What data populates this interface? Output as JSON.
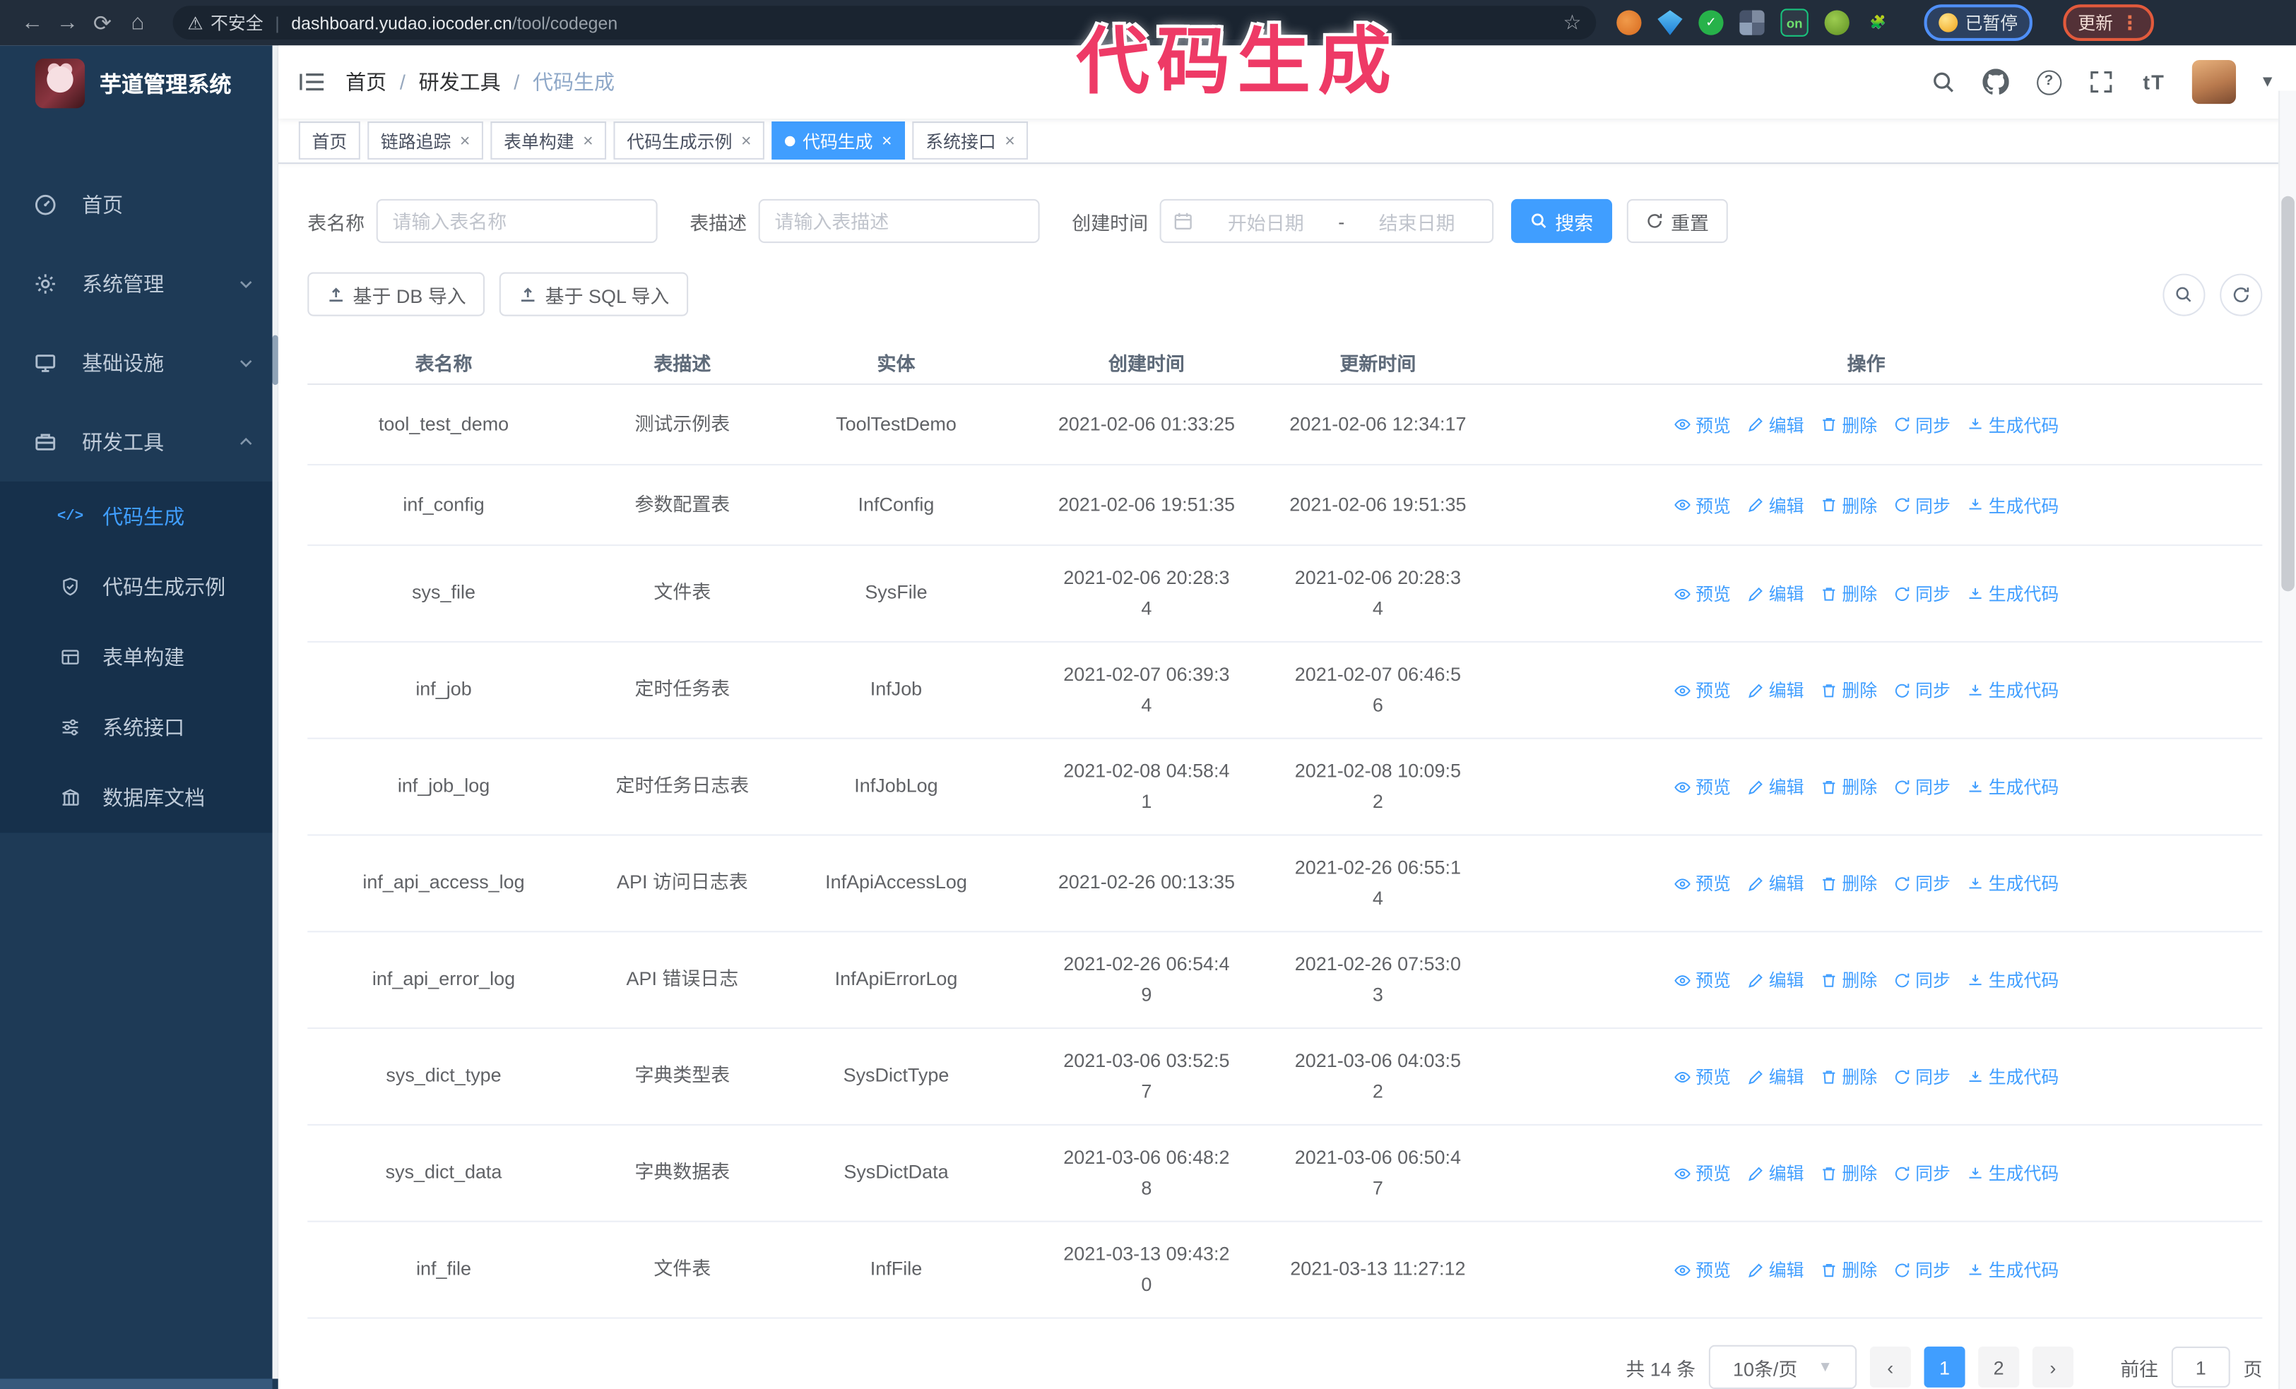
{
  "browser": {
    "security_label": "不安全",
    "url_host": "dashboard.yudao.iocoder.cn",
    "url_path": "/tool/codegen",
    "paused_badge": "已暂停",
    "update_badge": "更新",
    "extension_icons": [
      "orange-extension",
      "blue-gem-extension",
      "green-check-extension",
      "grid-extension",
      "proxy-on-extension",
      "green-extension",
      "puzzle-extension"
    ]
  },
  "annotation": {
    "text": "代码生成",
    "color": "#ee3a66"
  },
  "sidebar": {
    "title": "芋道管理系统",
    "items": [
      {
        "label": "首页",
        "icon": "gauge-icon"
      },
      {
        "label": "系统管理",
        "icon": "gear-icon",
        "state": "collapsed"
      },
      {
        "label": "基础设施",
        "icon": "monitor-icon",
        "state": "collapsed"
      },
      {
        "label": "研发工具",
        "icon": "toolbox-icon",
        "state": "expanded"
      }
    ],
    "submenu": [
      {
        "label": "代码生成",
        "icon": "code-icon",
        "active": true
      },
      {
        "label": "代码生成示例",
        "icon": "shield-check-icon",
        "active": false
      },
      {
        "label": "表单构建",
        "icon": "form-icon",
        "active": false
      },
      {
        "label": "系统接口",
        "icon": "sliders-icon",
        "active": false
      },
      {
        "label": "数据库文档",
        "icon": "columns-icon",
        "active": false
      }
    ]
  },
  "header": {
    "breadcrumb": [
      "首页",
      "研发工具",
      "代码生成"
    ]
  },
  "tabs": [
    {
      "label": "首页",
      "closable": false,
      "active": false
    },
    {
      "label": "链路追踪",
      "closable": true,
      "active": false
    },
    {
      "label": "表单构建",
      "closable": true,
      "active": false
    },
    {
      "label": "代码生成示例",
      "closable": true,
      "active": false
    },
    {
      "label": "代码生成",
      "closable": true,
      "active": true
    },
    {
      "label": "系统接口",
      "closable": true,
      "active": false
    }
  ],
  "filters": {
    "table_name_label": "表名称",
    "table_name_placeholder": "请输入表名称",
    "table_desc_label": "表描述",
    "table_desc_placeholder": "请输入表描述",
    "create_time_label": "创建时间",
    "start_placeholder": "开始日期",
    "range_separator": "-",
    "end_placeholder": "结束日期",
    "search_label": "搜索",
    "reset_label": "重置"
  },
  "toolbar": {
    "db_import_label": "基于 DB 导入",
    "sql_import_label": "基于 SQL 导入"
  },
  "table": {
    "columns": [
      "表名称",
      "表描述",
      "实体",
      "创建时间",
      "更新时间",
      "操作"
    ],
    "actions": [
      "预览",
      "编辑",
      "删除",
      "同步",
      "生成代码"
    ],
    "rows": [
      {
        "name": "tool_test_demo",
        "desc": "测试示例表",
        "entity": "ToolTestDemo",
        "create_time": "2021-02-06 01:33:25",
        "update_time": "2021-02-06 12:34:17"
      },
      {
        "name": "inf_config",
        "desc": "参数配置表",
        "entity": "InfConfig",
        "create_time": "2021-02-06 19:51:35",
        "update_time": "2021-02-06 19:51:35"
      },
      {
        "name": "sys_file",
        "desc": "文件表",
        "entity": "SysFile",
        "create_time": "2021-02-06 20:28:3\n4",
        "update_time": "2021-02-06 20:28:3\n4"
      },
      {
        "name": "inf_job",
        "desc": "定时任务表",
        "entity": "InfJob",
        "create_time": "2021-02-07 06:39:3\n4",
        "update_time": "2021-02-07 06:46:5\n6"
      },
      {
        "name": "inf_job_log",
        "desc": "定时任务日志表",
        "entity": "InfJobLog",
        "create_time": "2021-02-08 04:58:4\n1",
        "update_time": "2021-02-08 10:09:5\n2"
      },
      {
        "name": "inf_api_access_log",
        "desc": "API 访问日志表",
        "entity": "InfApiAccessLog",
        "create_time": "2021-02-26 00:13:35",
        "update_time": "2021-02-26 06:55:1\n4"
      },
      {
        "name": "inf_api_error_log",
        "desc": "API 错误日志",
        "entity": "InfApiErrorLog",
        "create_time": "2021-02-26 06:54:4\n9",
        "update_time": "2021-02-26 07:53:0\n3"
      },
      {
        "name": "sys_dict_type",
        "desc": "字典类型表",
        "entity": "SysDictType",
        "create_time": "2021-03-06 03:52:5\n7",
        "update_time": "2021-03-06 04:03:5\n2"
      },
      {
        "name": "sys_dict_data",
        "desc": "字典数据表",
        "entity": "SysDictData",
        "create_time": "2021-03-06 06:48:2\n8",
        "update_time": "2021-03-06 06:50:4\n7"
      },
      {
        "name": "inf_file",
        "desc": "文件表",
        "entity": "InfFile",
        "create_time": "2021-03-13 09:43:2\n0",
        "update_time": "2021-03-13 11:27:12"
      }
    ]
  },
  "pagination": {
    "total_label": "共 14 条",
    "page_size_label": "10条/页",
    "pages": [
      "1",
      "2"
    ],
    "active_page": "1",
    "goto_label": "前往",
    "goto_value": "1",
    "page_unit_label": "页"
  },
  "colors": {
    "primary": "#409eff",
    "sidebar_bg": "#1e3a56",
    "submenu_bg": "#16304b",
    "annotation": "#ee3a66"
  }
}
